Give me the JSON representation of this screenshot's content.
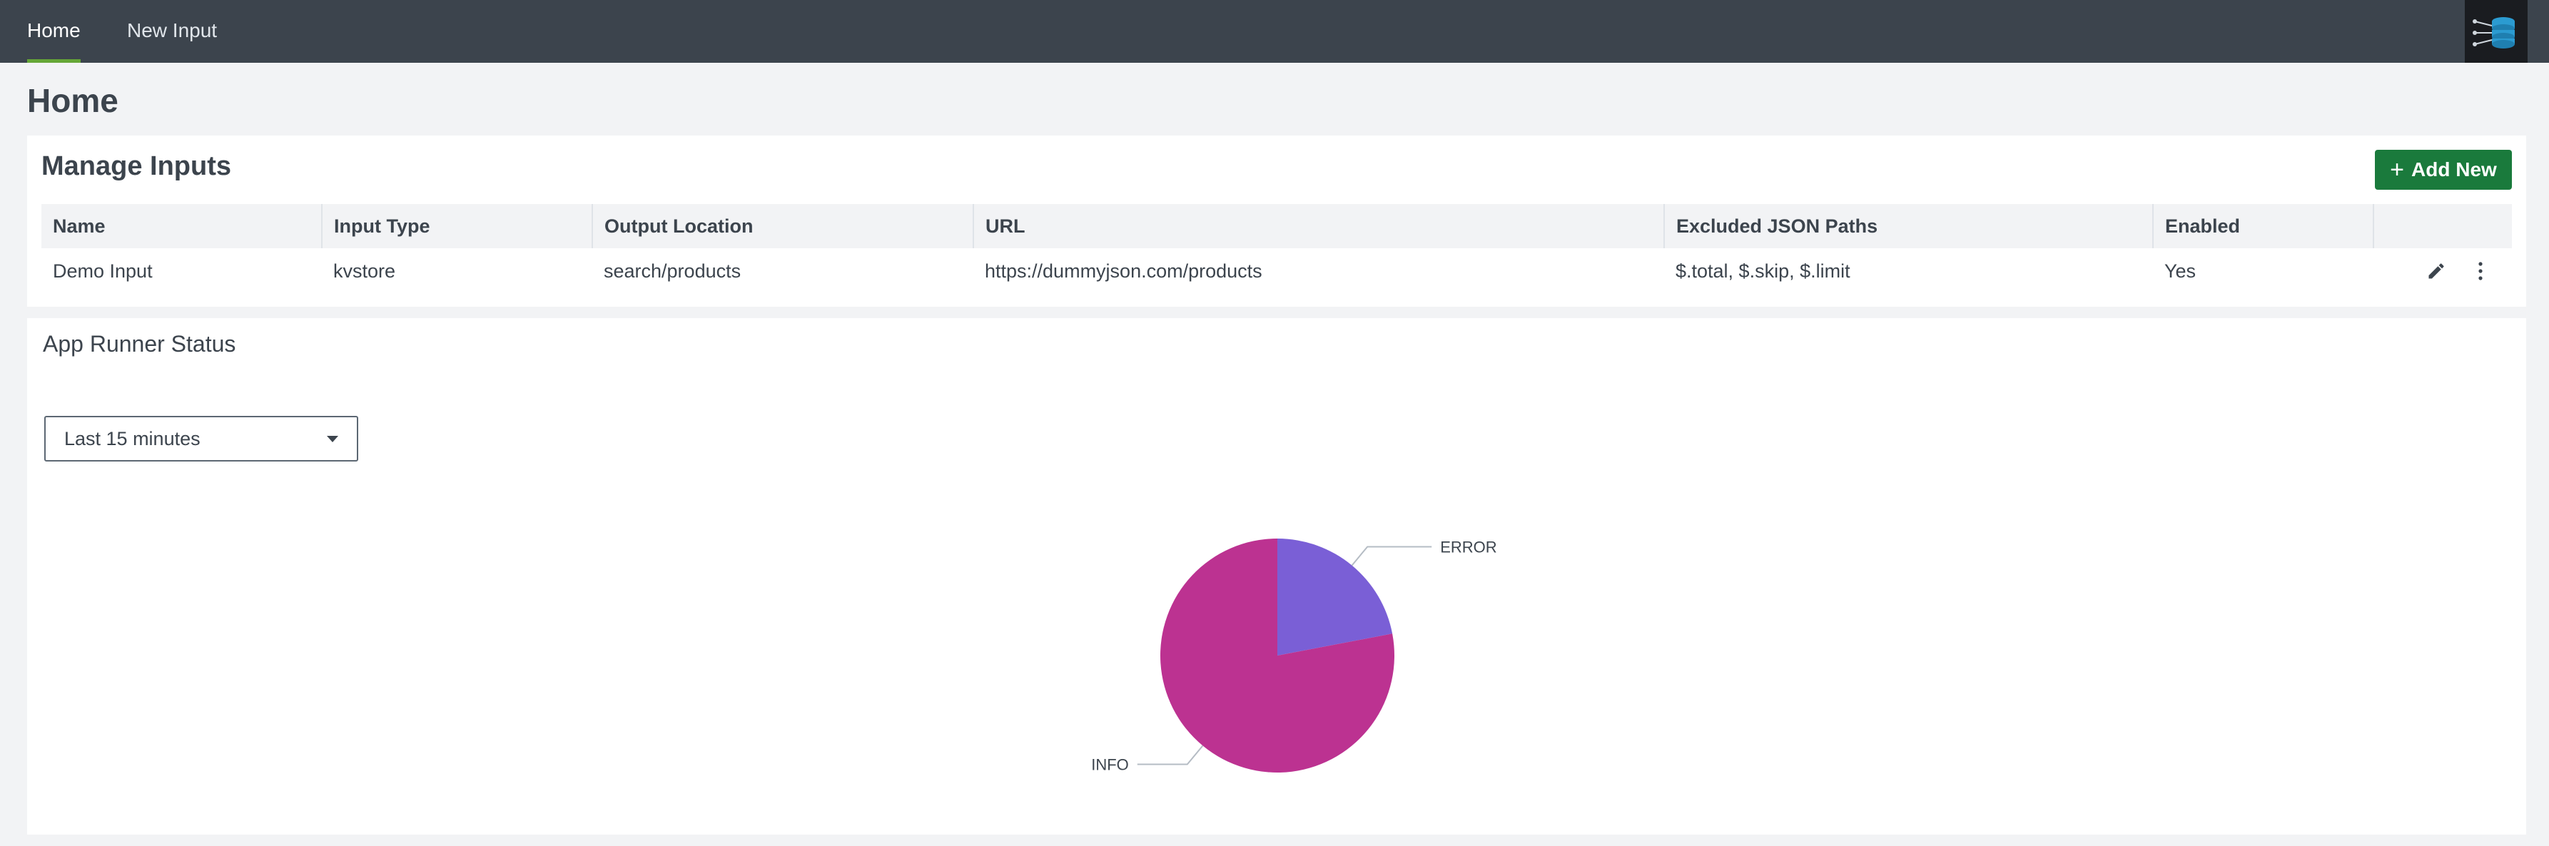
{
  "nav": {
    "tabs": [
      {
        "label": "Home",
        "active": true
      },
      {
        "label": "New Input",
        "active": false
      }
    ],
    "logo_icon": "database-network-icon"
  },
  "page": {
    "title": "Home"
  },
  "manage_inputs": {
    "title": "Manage Inputs",
    "add_button": "Add New",
    "columns": [
      "Name",
      "Input Type",
      "Output Location",
      "URL",
      "Excluded JSON Paths",
      "Enabled",
      ""
    ],
    "rows": [
      {
        "name": "Demo Input",
        "input_type": "kvstore",
        "output_location": "search/products",
        "url": "https://dummyjson.com/products",
        "excluded_json_paths": "$.total, $.skip, $.limit",
        "enabled": "Yes"
      }
    ]
  },
  "status": {
    "title": "App Runner Status",
    "time_range": "Last 15 minutes"
  },
  "colors": {
    "topbar": "#3c444d",
    "accent_green": "#65a637",
    "button_green": "#1a7a3c",
    "info": "#bc3291",
    "error": "#7a5fd6"
  },
  "chart_data": {
    "type": "pie",
    "slices": [
      {
        "label": "ERROR",
        "value": 22,
        "color": "#7a5fd6"
      },
      {
        "label": "INFO",
        "value": 78,
        "color": "#bc3291"
      }
    ]
  }
}
